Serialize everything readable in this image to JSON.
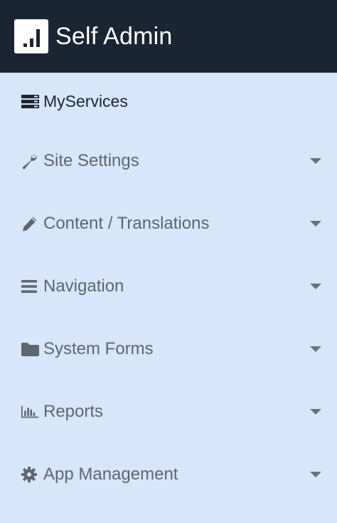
{
  "header": {
    "title": "Self Admin",
    "logo_icon": "bar-chart-logo-icon"
  },
  "menu": {
    "items": [
      {
        "label": "MyServices",
        "icon": "server-icon",
        "has_dropdown": false
      },
      {
        "label": "Site Settings",
        "icon": "wrench-icon",
        "has_dropdown": true
      },
      {
        "label": "Content / Translations",
        "icon": "pencil-icon",
        "has_dropdown": true
      },
      {
        "label": "Navigation",
        "icon": "bars-icon",
        "has_dropdown": true
      },
      {
        "label": "System Forms",
        "icon": "folder-icon",
        "has_dropdown": true
      },
      {
        "label": "Reports",
        "icon": "bar-chart-icon",
        "has_dropdown": true
      },
      {
        "label": "App Management",
        "icon": "gear-icon",
        "has_dropdown": true
      }
    ]
  },
  "colors": {
    "header_bg": "#1a2533",
    "sidebar_bg": "#d6e6fb",
    "item_text": "#5f6671",
    "active_text": "#1d2530"
  }
}
